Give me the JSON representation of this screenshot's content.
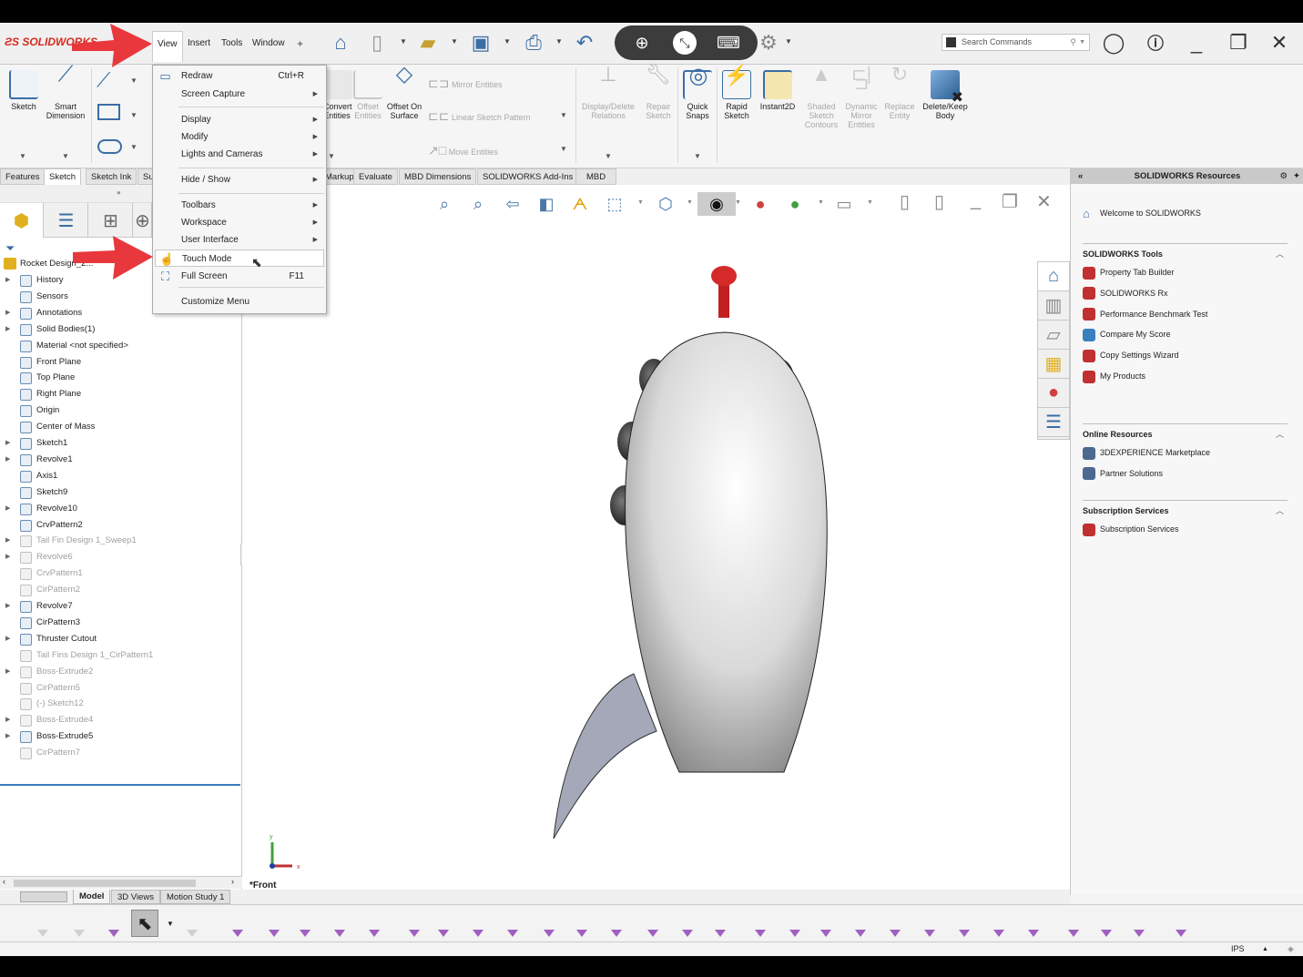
{
  "app": {
    "brand": "SOLIDWORKS"
  },
  "menubar": {
    "items": [
      "View",
      "Insert",
      "Tools",
      "Window"
    ],
    "active": "View"
  },
  "quick_access": {
    "icons": [
      "home-icon",
      "new-document-icon",
      "open-icon",
      "save-icon",
      "print-icon",
      "undo-icon",
      "options-gear-icon"
    ]
  },
  "remote_overlay": {
    "icons": [
      "zoom-in-icon",
      "remote-connect-icon",
      "keyboard-icon"
    ]
  },
  "search": {
    "placeholder": "Search Commands"
  },
  "ribbon": {
    "sketch": "Sketch",
    "smart_dimension": "Smart Dimension",
    "convert_entities": "Convert Entities",
    "offset_entities": "Offset Entities",
    "offset_on_surface": "Offset On Surface",
    "mirror_entities": "Mirror Entities",
    "linear_sketch_pattern": "Linear Sketch Pattern",
    "move_entities": "Move Entities",
    "display_delete_relations": "Display/Delete Relations",
    "repair_sketch": "Repair Sketch",
    "quick_snaps": "Quick Snaps",
    "rapid_sketch": "Rapid Sketch",
    "instant2d": "Instant2D",
    "shaded_sketch_contours": "Shaded Sketch Contours",
    "dynamic_mirror_entities": "Dynamic Mirror Entities",
    "replace_entity": "Replace Entity",
    "delete_keep_body": "Delete/Keep Body"
  },
  "command_tabs": [
    "Features",
    "Sketch",
    "Sketch Ink",
    "Su",
    "Markup",
    "Evaluate",
    "MBD Dimensions",
    "SOLIDWORKS Add-Ins",
    "MBD"
  ],
  "active_command_tab": "Sketch",
  "view_menu": {
    "items": [
      {
        "label": "Redraw",
        "shortcut": "Ctrl+R",
        "submenu": false
      },
      {
        "label": "Screen Capture",
        "shortcut": "",
        "submenu": true
      },
      {
        "label": "Display",
        "shortcut": "",
        "submenu": true
      },
      {
        "label": "Modify",
        "shortcut": "",
        "submenu": true
      },
      {
        "label": "Lights and Cameras",
        "shortcut": "",
        "submenu": true
      },
      {
        "label": "Hide / Show",
        "shortcut": "",
        "submenu": true
      },
      {
        "label": "Toolbars",
        "shortcut": "",
        "submenu": true
      },
      {
        "label": "Workspace",
        "shortcut": "",
        "submenu": true
      },
      {
        "label": "User Interface",
        "shortcut": "",
        "submenu": true
      },
      {
        "label": "Touch Mode",
        "shortcut": "",
        "submenu": false,
        "highlighted": true
      },
      {
        "label": "Full Screen",
        "shortcut": "F11",
        "submenu": false
      },
      {
        "label": "Customize Menu",
        "shortcut": "",
        "submenu": false
      }
    ]
  },
  "feature_tree": {
    "root": "Rocket Design_2...",
    "items": [
      {
        "label": "History",
        "expandable": true,
        "suppressed": false
      },
      {
        "label": "Sensors",
        "expandable": false,
        "suppressed": false
      },
      {
        "label": "Annotations",
        "expandable": true,
        "suppressed": false
      },
      {
        "label": "Solid Bodies(1)",
        "expandable": true,
        "suppressed": false
      },
      {
        "label": "Material <not specified>",
        "expandable": false,
        "suppressed": false
      },
      {
        "label": "Front Plane",
        "expandable": false,
        "suppressed": false
      },
      {
        "label": "Top Plane",
        "expandable": false,
        "suppressed": false
      },
      {
        "label": "Right Plane",
        "expandable": false,
        "suppressed": false
      },
      {
        "label": "Origin",
        "expandable": false,
        "suppressed": false
      },
      {
        "label": "Center of Mass",
        "expandable": false,
        "suppressed": false
      },
      {
        "label": "Sketch1",
        "expandable": true,
        "suppressed": false
      },
      {
        "label": "Revolve1",
        "expandable": true,
        "suppressed": false
      },
      {
        "label": "Axis1",
        "expandable": false,
        "suppressed": false
      },
      {
        "label": "Sketch9",
        "expandable": false,
        "suppressed": false
      },
      {
        "label": "Revolve10",
        "expandable": true,
        "suppressed": false
      },
      {
        "label": "CrvPattern2",
        "expandable": false,
        "suppressed": false
      },
      {
        "label": "Tail Fin Design 1_Sweep1",
        "expandable": true,
        "suppressed": true
      },
      {
        "label": "Revolve6",
        "expandable": true,
        "suppressed": true
      },
      {
        "label": "CrvPattern1",
        "expandable": false,
        "suppressed": true
      },
      {
        "label": "CirPattern2",
        "expandable": false,
        "suppressed": true
      },
      {
        "label": "Revolve7",
        "expandable": true,
        "suppressed": false
      },
      {
        "label": "CirPattern3",
        "expandable": false,
        "suppressed": false
      },
      {
        "label": "Thruster Cutout",
        "expandable": true,
        "suppressed": false
      },
      {
        "label": "Tail Fins Design 1_CirPattern1",
        "expandable": false,
        "suppressed": true
      },
      {
        "label": "Boss-Extrude2",
        "expandable": true,
        "suppressed": true
      },
      {
        "label": "CirPattern5",
        "expandable": false,
        "suppressed": true
      },
      {
        "label": "(-) Sketch12",
        "expandable": false,
        "suppressed": true
      },
      {
        "label": "Boss-Extrude4",
        "expandable": true,
        "suppressed": true
      },
      {
        "label": "Boss-Extrude5",
        "expandable": true,
        "suppressed": false
      },
      {
        "label": "CirPattern7",
        "expandable": false,
        "suppressed": true
      }
    ]
  },
  "viewport": {
    "view_label": "*Front",
    "triad": {
      "x": "x",
      "y": "y"
    }
  },
  "resources_panel": {
    "title": "SOLIDWORKS Resources",
    "welcome": "Welcome to SOLIDWORKS",
    "sections": [
      {
        "title": "SOLIDWORKS Tools",
        "links": [
          "Property Tab Builder",
          "SOLIDWORKS Rx",
          "Performance Benchmark Test",
          "Compare My Score",
          "Copy Settings Wizard",
          "My Products"
        ]
      },
      {
        "title": "Online Resources",
        "links": [
          "3DEXPERIENCE Marketplace",
          "Partner Solutions"
        ]
      },
      {
        "title": "Subscription Services",
        "links": [
          "Subscription Services"
        ]
      }
    ]
  },
  "bottom_tabs": [
    "Model",
    "3D Views",
    "Motion Study 1"
  ],
  "active_bottom_tab": "Model",
  "status": {
    "units": "IPS"
  }
}
